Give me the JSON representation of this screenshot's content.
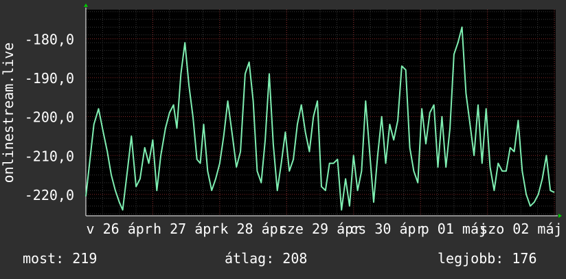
{
  "chart_data": {
    "type": "line",
    "ylabel": "onlinestream.live",
    "ylim": [
      -225.5,
      -172.5
    ],
    "y_ticks": [
      "-180,0",
      "-190,0",
      "-200,0",
      "-210,0",
      "-220,0"
    ],
    "y_tick_values": [
      -180,
      -190,
      -200,
      -210,
      -220
    ],
    "x_ticks": [
      "v 26 ápr",
      "h 27 ápr",
      "k 28 ápr",
      "sze 29 ápr",
      "cs 30 ápr",
      "p 01 máj",
      "szo 02 máj"
    ],
    "x_tick_positions": [
      0.5,
      1.5,
      2.5,
      3.5,
      4.5,
      5.5,
      6.5
    ],
    "xlim": [
      0.0,
      7.02
    ],
    "grid": true,
    "colors": {
      "line": "#7fefb2",
      "background": "#000000",
      "panel": "#2f2f2f",
      "grid_major": "#8a2a2a",
      "grid_minor": "#3a3a3a",
      "axis_arrow": "#00cc00",
      "text": "#ffffff"
    },
    "series": [
      {
        "name": "",
        "x": [
          0.0,
          0.12,
          0.19,
          0.26,
          0.32,
          0.38,
          0.44,
          0.5,
          0.55,
          0.62,
          0.68,
          0.75,
          0.81,
          0.88,
          0.94,
          1.0,
          1.06,
          1.12,
          1.19,
          1.25,
          1.31,
          1.36,
          1.42,
          1.48,
          1.54,
          1.6,
          1.66,
          1.71,
          1.76,
          1.82,
          1.88,
          1.94,
          2.0,
          2.06,
          2.12,
          2.19,
          2.25,
          2.31,
          2.38,
          2.44,
          2.5,
          2.56,
          2.62,
          2.68,
          2.74,
          2.8,
          2.86,
          2.92,
          2.98,
          3.04,
          3.1,
          3.16,
          3.22,
          3.28,
          3.34,
          3.4,
          3.46,
          3.52,
          3.58,
          3.64,
          3.7,
          3.76,
          3.82,
          3.88,
          3.94,
          4.0,
          4.06,
          4.12,
          4.18,
          4.24,
          4.3,
          4.36,
          4.42,
          4.48,
          4.54,
          4.6,
          4.66,
          4.72,
          4.78,
          4.84,
          4.9,
          4.96,
          5.02,
          5.08,
          5.14,
          5.2,
          5.26,
          5.32,
          5.38,
          5.44,
          5.5,
          5.56,
          5.62,
          5.68,
          5.74,
          5.8,
          5.86,
          5.92,
          5.98,
          6.04,
          6.1,
          6.16,
          6.22,
          6.28,
          6.34,
          6.4,
          6.46,
          6.52,
          6.58,
          6.64,
          6.7,
          6.76,
          6.82,
          6.88,
          6.94,
          7.0
        ],
        "values": [
          -220.5,
          -202.0,
          -198.0,
          -204.0,
          -209.0,
          -215.0,
          -219.0,
          -222.0,
          -224.0,
          -214.0,
          -205.0,
          -218.0,
          -216.0,
          -208.0,
          -212.0,
          -206.0,
          -219.0,
          -210.0,
          -203.0,
          -199.0,
          -197.0,
          -203.0,
          -189.0,
          -181.0,
          -192.0,
          -200.0,
          -211.0,
          -212.0,
          -202.0,
          -214.0,
          -219.0,
          -216.0,
          -212.0,
          -205.0,
          -196.0,
          -205.0,
          -213.0,
          -209.0,
          -189.0,
          -186.0,
          -196.0,
          -214.0,
          -217.0,
          -206.0,
          -189.0,
          -207.0,
          -219.0,
          -212.0,
          -204.0,
          -214.0,
          -211.0,
          -202.0,
          -197.0,
          -204.0,
          -209.0,
          -200.0,
          -196.0,
          -218.0,
          -219.0,
          -212.0,
          -212.0,
          -211.0,
          -224.0,
          -216.0,
          -223.0,
          -210.0,
          -219.0,
          -214.0,
          -196.0,
          -209.0,
          -222.0,
          -210.0,
          -200.0,
          -212.0,
          -202.0,
          -206.0,
          -201.0,
          -187.0,
          -188.0,
          -208.0,
          -214.0,
          -217.0,
          -198.0,
          -207.0,
          -199.0,
          -197.0,
          -213.0,
          -200.0,
          -213.0,
          -203.0,
          -184.0,
          -181.0,
          -177.0,
          -194.0,
          -202.0,
          -210.0,
          -197.0,
          -212.0,
          -198.0,
          -213.0,
          -219.0,
          -212.0,
          -214.0,
          -214.0,
          -208.0,
          -209.0,
          -201.0,
          -214.0,
          -220.0,
          -223.0,
          -222.0,
          -220.0,
          -216.0,
          -210.0,
          -219.0,
          -219.5
        ]
      }
    ]
  },
  "stats": {
    "now_label": "most:",
    "now_value": "219",
    "avg_label": "átlag:",
    "avg_value": "208",
    "best_label": "legjobb:",
    "best_value": "176"
  }
}
